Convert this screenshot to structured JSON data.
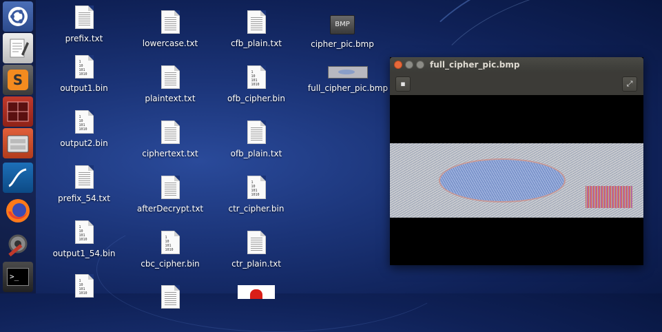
{
  "launcher": {
    "items": [
      {
        "name": "dash-button",
        "icon": "ubuntu-logo-icon"
      },
      {
        "name": "text-editor",
        "icon": "text-editor-icon"
      },
      {
        "name": "sublime-text",
        "icon": "sublime-text-icon",
        "glyph": "S"
      },
      {
        "name": "terminal-emulator",
        "icon": "grid-terminal-icon"
      },
      {
        "name": "files",
        "icon": "file-cabinet-icon"
      },
      {
        "name": "wireshark",
        "icon": "wireshark-fin-icon"
      },
      {
        "name": "firefox",
        "icon": "firefox-icon"
      },
      {
        "name": "system-settings",
        "icon": "settings-tools-icon"
      },
      {
        "name": "terminal",
        "icon": "terminal-prompt-icon",
        "glyph": ">_"
      }
    ]
  },
  "desktop": {
    "col1": [
      "prefix.txt",
      "output1.bin",
      "output2.bin",
      "prefix_54.txt",
      "output1_54.bin"
    ],
    "col2": [
      "lowercase.txt",
      "plaintext.txt",
      "ciphertext.txt",
      "afterDecrypt.txt",
      "cbc_cipher.bin"
    ],
    "col3": [
      "cfb_plain.txt",
      "ofb_cipher.bin",
      "ofb_plain.txt",
      "ctr_cipher.bin",
      "ctr_plain.txt"
    ],
    "col4": [
      "cipher_pic.bmp",
      "full_cipher_pic.bmp"
    ],
    "bin_glyph": "1\n10\n101\n1010",
    "bmp_glyph": "BMP"
  },
  "window": {
    "title": "full_cipher_pic.bmp",
    "toolbar": {
      "left_icon": "pin-icon",
      "left_glyph": "▪",
      "right_icon": "fullscreen-icon",
      "right_glyph": "⤢"
    }
  },
  "colors": {
    "close_button": "#e8693a",
    "wallpaper": "#1b3478"
  }
}
